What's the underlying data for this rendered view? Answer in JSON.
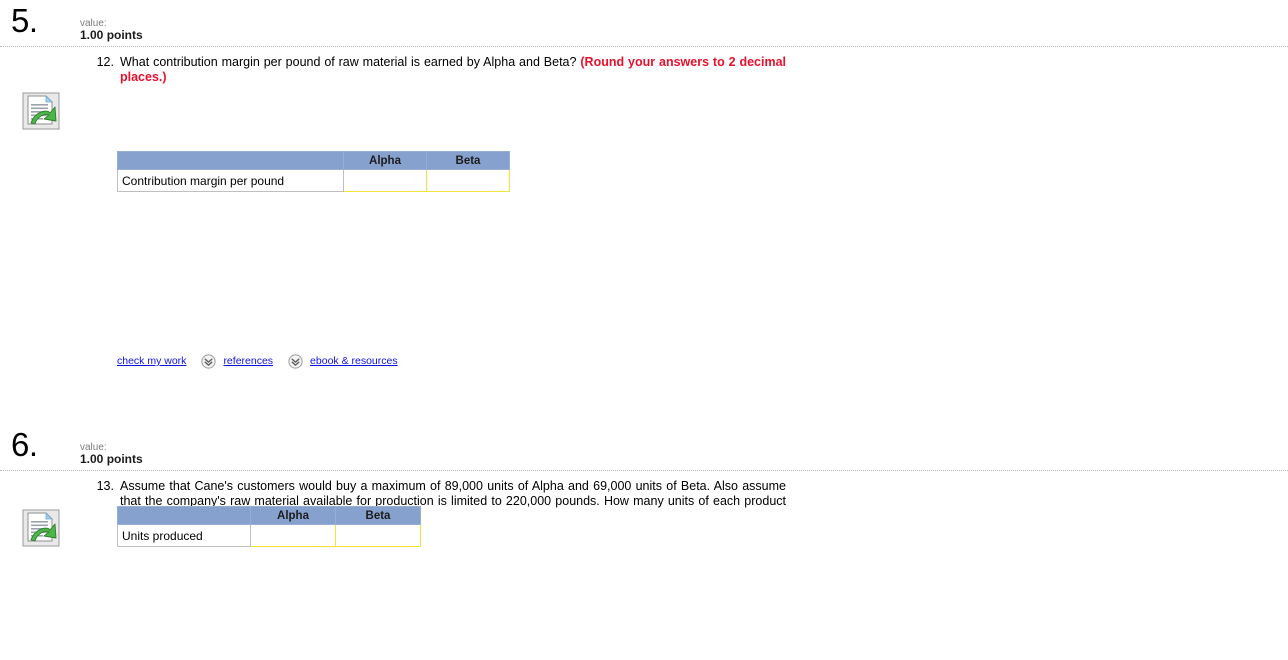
{
  "blocks": [
    {
      "number": "5.",
      "value_label": "value:",
      "points": "1.00 points",
      "question_number": "12.",
      "question_text": "What contribution margin per pound of raw material is earned by Alpha and Beta? ",
      "round_note": "(Round your answers to 2 decimal places.)",
      "table": {
        "corner_header": "",
        "headers": [
          "Alpha",
          "Beta"
        ],
        "rows": [
          {
            "label": "Contribution margin per pound",
            "alpha": "",
            "beta": ""
          }
        ]
      },
      "links": [
        {
          "label": "check my work",
          "icon": ""
        },
        {
          "label": "references",
          "icon": "chevron-double-down-icon"
        },
        {
          "label": "ebook & resources",
          "icon": "chevron-double-down-icon"
        }
      ]
    },
    {
      "number": "6.",
      "value_label": "value:",
      "points": "1.00 points",
      "question_number": "13.",
      "question_text": "Assume that Cane's customers would buy a maximum of 89,000 units of Alpha and 69,000 units of Beta. Also assume that the company's raw material available for production is limited to 220,000 pounds. How many units of each product should Cane produce to maximize its profits?",
      "round_note": "",
      "table": {
        "corner_header": "",
        "headers": [
          "Alpha",
          "Beta"
        ],
        "rows": [
          {
            "label": "Units produced",
            "alpha": "",
            "beta": ""
          }
        ]
      },
      "links": []
    }
  ],
  "colors": {
    "table_header_blue": "#87a1cf",
    "input_border_yellow": "#f2e33a",
    "link_blue": "#1111dd",
    "note_red": "#e8112d",
    "value_gray": "#7c7c7c"
  },
  "icons": {
    "document_arrow": "document-green-arrow-icon",
    "chevron": "chevron-double-down-icon"
  }
}
